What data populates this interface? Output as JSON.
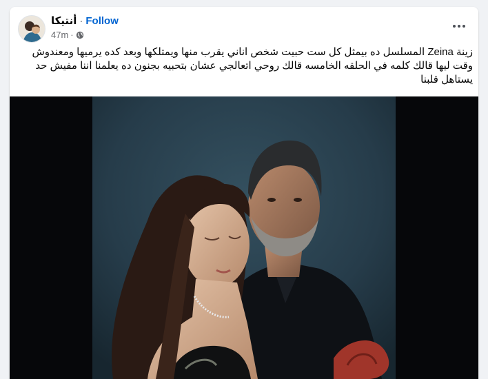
{
  "post": {
    "author": "أنتيكا",
    "separator": "·",
    "follow_label": "Follow",
    "time": "47m",
    "meta_separator": "·",
    "privacy_icon": "globe-icon",
    "more_icon": "more-options-icon",
    "text": "زينة Zeina المسلسل ده بيمثل كل ست حبيت شخص اناني   يقرب منها ويمتلكها وبعد كده يرميها ومعندوش وقت ليها قالك كلمه في الحلقه الخامسه قالك روحي اتعالجي عشان بتحبيه بجنون ده يعلمنا اننا مفيش حد يستاهل قلبنا"
  },
  "colors": {
    "follow": "#0064d1",
    "photo_background": "#263c4a",
    "letterbox": "#06070a"
  }
}
